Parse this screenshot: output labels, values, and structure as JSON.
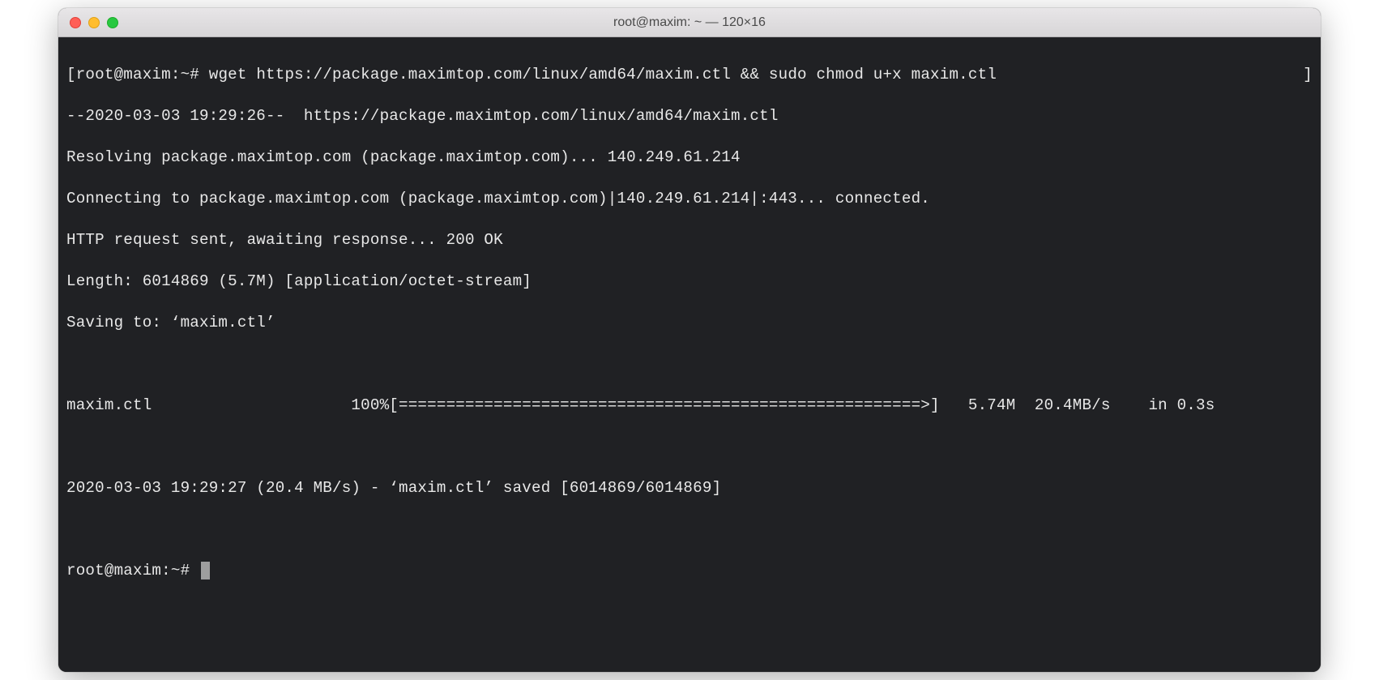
{
  "window": {
    "title": "root@maxim: ~ — 120×16"
  },
  "terminal": {
    "prompt1_open": "[",
    "prompt1_user": "root@maxim",
    "prompt1_sep": ":",
    "prompt1_path": "~#",
    "command": " wget https://package.maximtop.com/linux/amd64/maxim.ctl && sudo chmod u+x maxim.ctl",
    "prompt1_close": "]",
    "line2": "--2020-03-03 19:29:26--  https://package.maximtop.com/linux/amd64/maxim.ctl",
    "line3": "Resolving package.maximtop.com (package.maximtop.com)... 140.249.61.214",
    "line4": "Connecting to package.maximtop.com (package.maximtop.com)|140.249.61.214|:443... connected.",
    "line5": "HTTP request sent, awaiting response... 200 OK",
    "line6": "Length: 6014869 (5.7M) [application/octet-stream]",
    "line7": "Saving to: ‘maxim.ctl’",
    "blank1": " ",
    "progress": "maxim.ctl                     100%[=======================================================>]   5.74M  20.4MB/s    in 0.3s",
    "blank2": " ",
    "line_saved": "2020-03-03 19:29:27 (20.4 MB/s) - ‘maxim.ctl’ saved [6014869/6014869]",
    "blank3": " ",
    "prompt2": "root@maxim:~# "
  }
}
